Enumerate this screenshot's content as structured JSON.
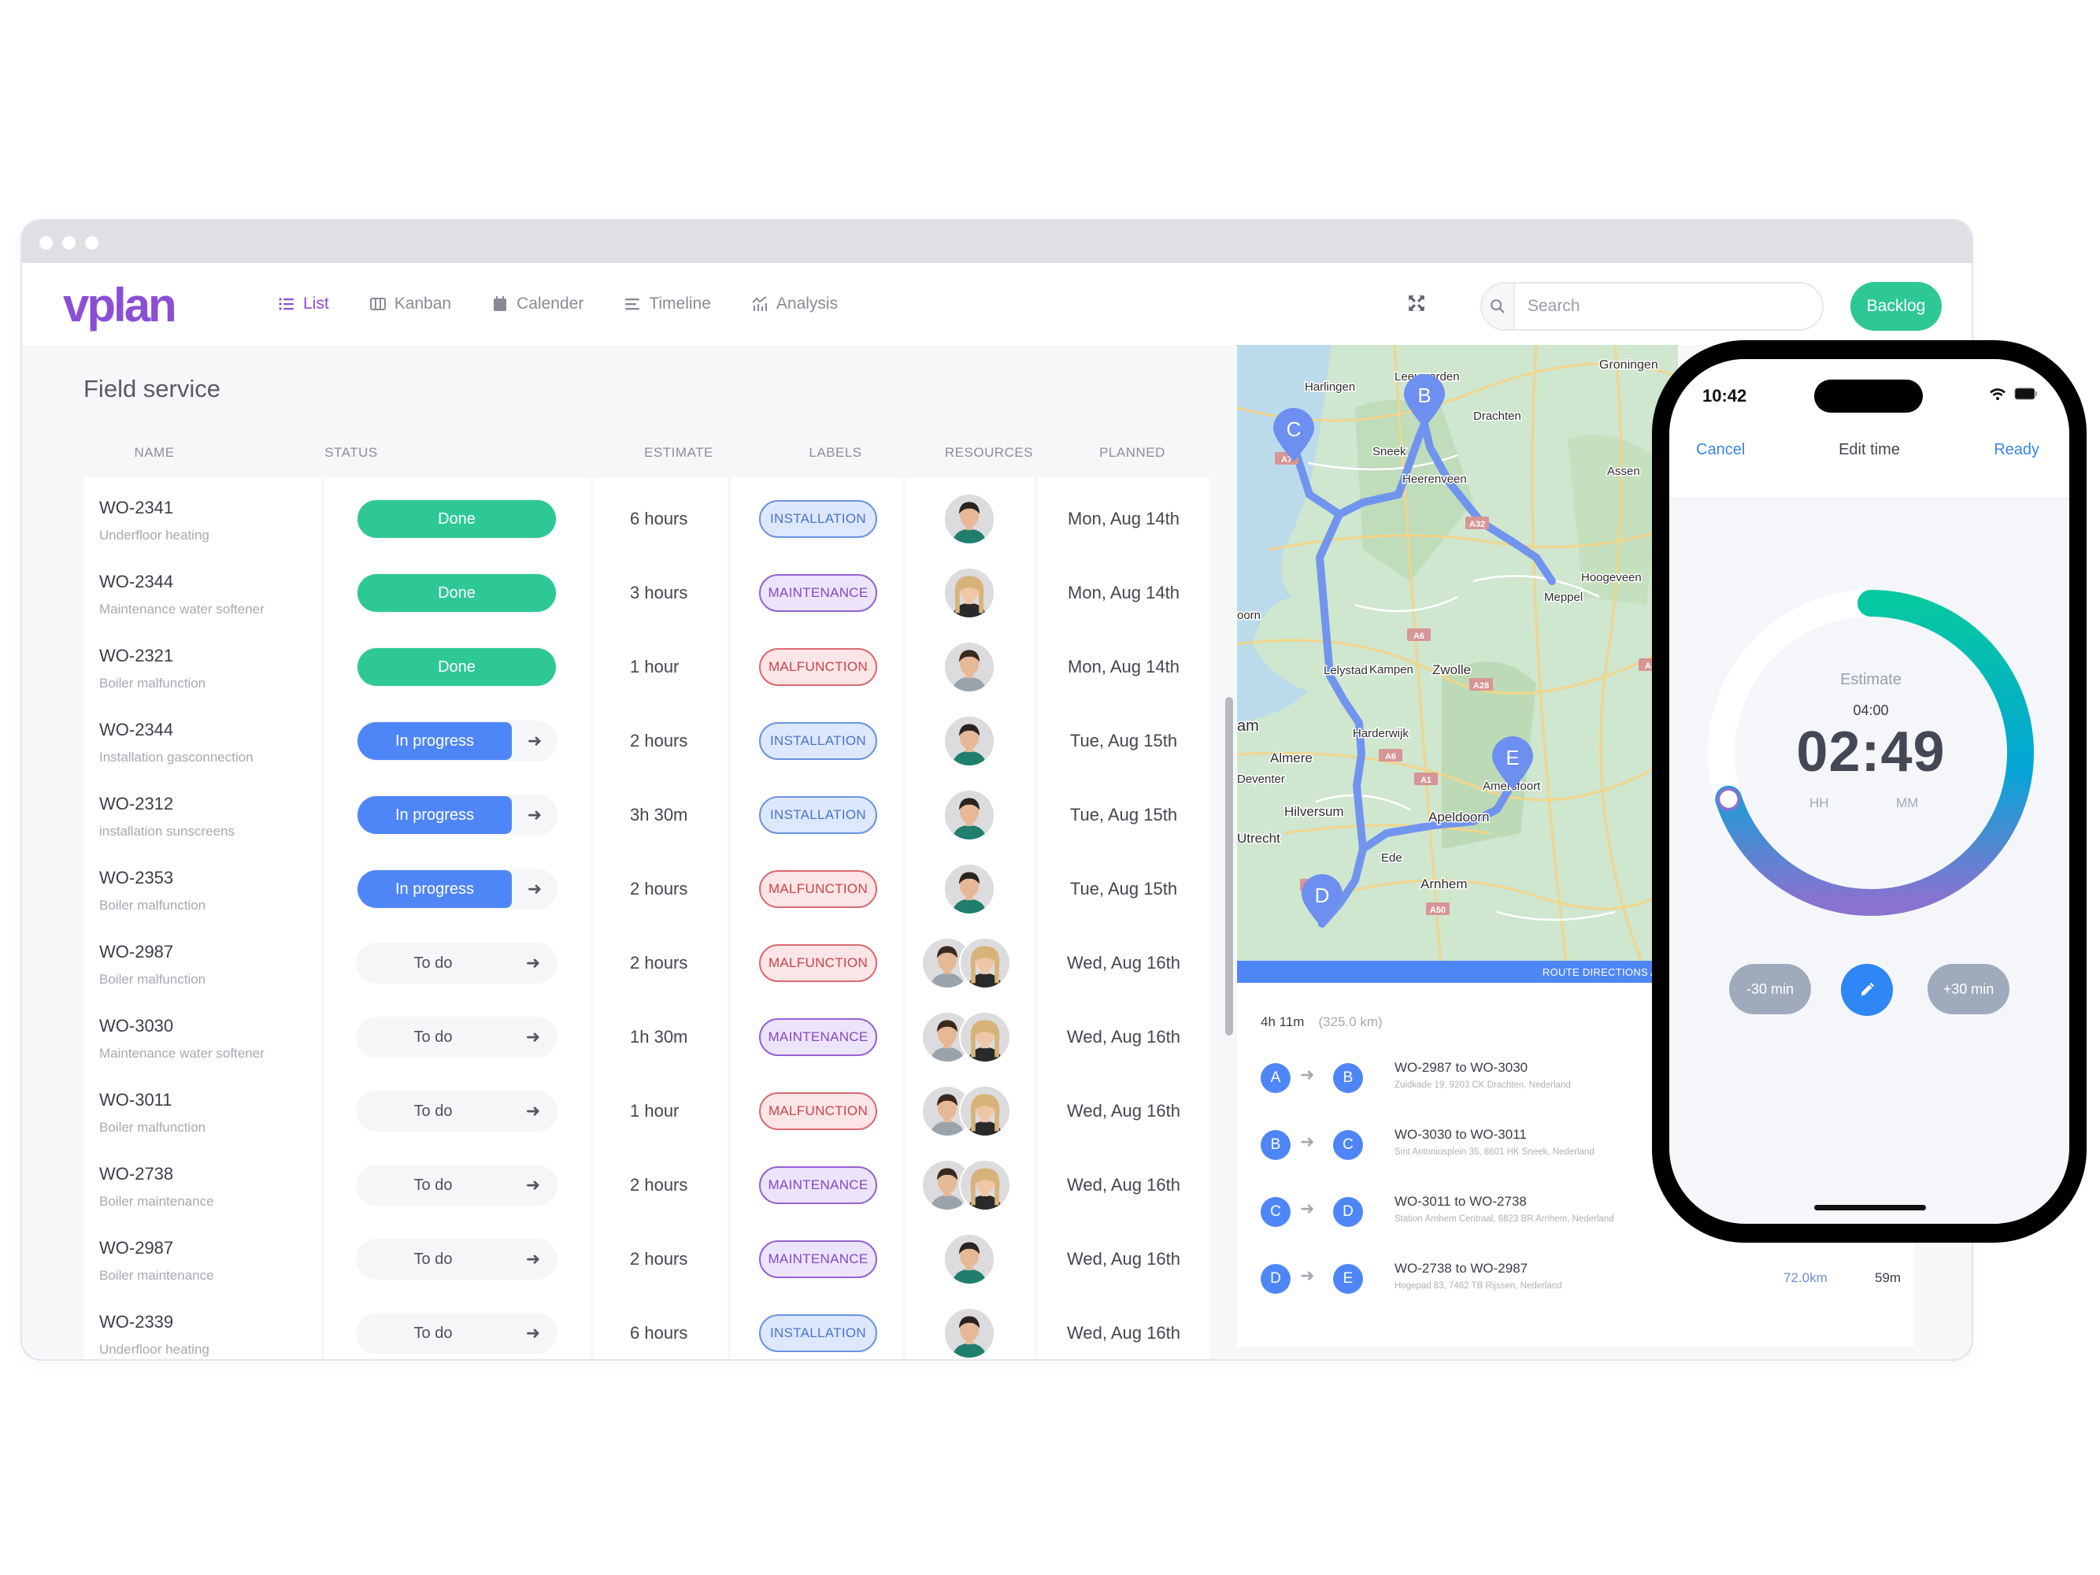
{
  "app": {
    "brand": "vplan",
    "brand_color": "#8b4fd6",
    "nav": [
      {
        "label": "List",
        "icon": "list-icon",
        "active": true
      },
      {
        "label": "Kanban",
        "icon": "kanban-icon",
        "active": false
      },
      {
        "label": "Calender",
        "icon": "calendar-icon",
        "active": false
      },
      {
        "label": "Timeline",
        "icon": "timeline-icon",
        "active": false
      },
      {
        "label": "Analysis",
        "icon": "analysis-icon",
        "active": false
      }
    ],
    "search": {
      "placeholder": "Search",
      "value": ""
    },
    "backlog_label": "Backlog"
  },
  "list": {
    "title": "Field service",
    "columns": [
      "NAME",
      "STATUS",
      "ESTIMATE",
      "LABELS",
      "RESOURCES",
      "PLANNED"
    ],
    "rows": [
      {
        "id": "WO-2341",
        "desc": "Underfloor heating",
        "status": "Done",
        "status_type": "done",
        "estimate": "6 hours",
        "label": "INSTALLATION",
        "label_type": "installation",
        "resources": [
          "man-1"
        ],
        "planned": "Mon, Aug 14th"
      },
      {
        "id": "WO-2344",
        "desc": "Maintenance water softener",
        "status": "Done",
        "status_type": "done",
        "estimate": "3 hours",
        "label": "MAINTENANCE",
        "label_type": "maintenance",
        "resources": [
          "woman-1"
        ],
        "planned": "Mon, Aug 14th"
      },
      {
        "id": "WO-2321",
        "desc": "Boiler malfunction",
        "status": "Done",
        "status_type": "done",
        "estimate": "1 hour",
        "label": "MALFUNCTION",
        "label_type": "malfunction",
        "resources": [
          "man-2"
        ],
        "planned": "Mon, Aug 14th"
      },
      {
        "id": "WO-2344",
        "desc": "Installation gasconnection",
        "status": "In progress",
        "status_type": "progress",
        "estimate": "2 hours",
        "label": "INSTALLATION",
        "label_type": "installation",
        "resources": [
          "man-1"
        ],
        "planned": "Tue, Aug 15th"
      },
      {
        "id": "WO-2312",
        "desc": "installation sunscreens",
        "status": "In progress",
        "status_type": "progress",
        "estimate": "3h 30m",
        "label": "INSTALLATION",
        "label_type": "installation",
        "resources": [
          "man-1"
        ],
        "planned": "Tue, Aug 15th"
      },
      {
        "id": "WO-2353",
        "desc": "Boiler malfunction",
        "status": "In progress",
        "status_type": "progress",
        "estimate": "2 hours",
        "label": "MALFUNCTION",
        "label_type": "malfunction",
        "resources": [
          "man-1"
        ],
        "planned": "Tue, Aug 15th"
      },
      {
        "id": "WO-2987",
        "desc": "Boiler malfunction",
        "status": "To do",
        "status_type": "todo",
        "estimate": "2 hours",
        "label": "MALFUNCTION",
        "label_type": "malfunction",
        "resources": [
          "man-2",
          "woman-1"
        ],
        "planned": "Wed, Aug 16th"
      },
      {
        "id": "WO-3030",
        "desc": "Maintenance water softener",
        "status": "To do",
        "status_type": "todo",
        "estimate": "1h 30m",
        "label": "MAINTENANCE",
        "label_type": "maintenance",
        "resources": [
          "man-2",
          "woman-1"
        ],
        "planned": "Wed, Aug 16th"
      },
      {
        "id": "WO-3011",
        "desc": "Boiler malfunction",
        "status": "To do",
        "status_type": "todo",
        "estimate": "1 hour",
        "label": "MALFUNCTION",
        "label_type": "malfunction",
        "resources": [
          "man-2",
          "woman-1"
        ],
        "planned": "Wed, Aug 16th"
      },
      {
        "id": "WO-2738",
        "desc": "Boiler maintenance",
        "status": "To do",
        "status_type": "todo",
        "estimate": "2 hours",
        "label": "MAINTENANCE",
        "label_type": "maintenance",
        "resources": [
          "man-2",
          "woman-1"
        ],
        "planned": "Wed, Aug 16th"
      },
      {
        "id": "WO-2987",
        "desc": "Boiler maintenance",
        "status": "To do",
        "status_type": "todo",
        "estimate": "2 hours",
        "label": "MAINTENANCE",
        "label_type": "maintenance",
        "resources": [
          "man-1"
        ],
        "planned": "Wed, Aug 16th"
      },
      {
        "id": "WO-2339",
        "desc": "Underfloor heating",
        "status": "To do",
        "status_type": "todo",
        "estimate": "6 hours",
        "label": "INSTALLATION",
        "label_type": "installation",
        "resources": [
          "man-1"
        ],
        "planned": "Wed, Aug 16th"
      }
    ]
  },
  "map": {
    "places": [
      "Leeuwarden",
      "Harlingen",
      "Groningen",
      "Drachten",
      "Sneek",
      "Heerenveen",
      "Assen",
      "Meppel",
      "Hoogeveen",
      "oorn",
      "Lelystad",
      "Kampen",
      "Zwolle",
      "am",
      "Harderwijk",
      "Almere",
      "Deventer",
      "Hilversum",
      "Amersfoort",
      "Apeldoorn",
      "Utrecht",
      "Ede",
      "Arnhem"
    ],
    "road_labels": [
      "A7",
      "A32",
      "A6",
      "A6",
      "A28",
      "A1",
      "A28",
      "A50",
      "A3"
    ],
    "markers": [
      "B",
      "C",
      "D",
      "E"
    ],
    "route_bar_label": "ROUTE DIRECTIONS ACTI"
  },
  "directions": {
    "duration": "4h 11m",
    "distance": "(325.0 km)",
    "legs": [
      {
        "from": "A",
        "to": "B",
        "title": "WO-2987 to WO-3030",
        "address": "Zuidkade 19, 9203 CK Drachten, Nederland",
        "km": "",
        "time": ""
      },
      {
        "from": "B",
        "to": "C",
        "title": "WO-3030 to WO-3011",
        "address": "Sint Antoniusplein 35, 8601 HK Sneek, Nederland",
        "km": "",
        "time": ""
      },
      {
        "from": "C",
        "to": "D",
        "title": "WO-3011 to WO-2738",
        "address": "Station Arnhem Centraal, 6823 BR Arnhem, Nederland",
        "km": "",
        "time": ""
      },
      {
        "from": "D",
        "to": "E",
        "title": "WO-2738 to WO-2987",
        "address": "Hogepad 83, 7462 TB Rijssen, Nederland",
        "km": "72.0km",
        "time": "59m"
      }
    ]
  },
  "phone": {
    "clock": "10:42",
    "cancel": "Cancel",
    "title": "Edit time",
    "ready": "Ready",
    "estimate_label": "Estimate",
    "estimate_value": "04:00",
    "elapsed": "02:49",
    "unit_hours": "HH",
    "unit_minutes": "MM",
    "progress_fraction": 0.7,
    "minus_label": "-30 min",
    "plus_label": "+30 min"
  },
  "colors": {
    "done": "#2ec896",
    "progress": "#4f86f7",
    "route": "#6c8ff0",
    "accent_blue": "#2f86f5"
  }
}
